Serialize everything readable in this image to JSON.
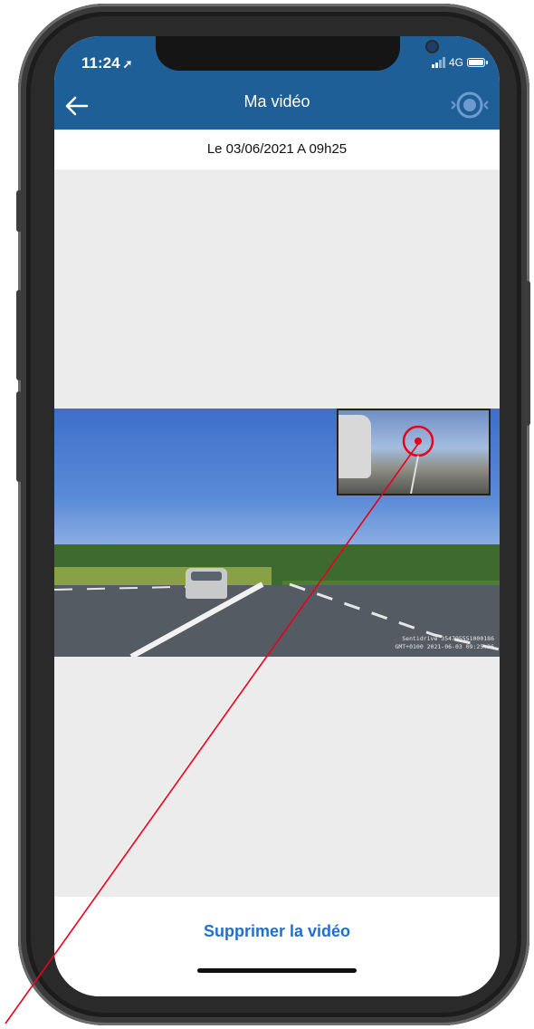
{
  "status_bar": {
    "time": "11:24",
    "network": "4G"
  },
  "header": {
    "title": "Ma vidéo"
  },
  "recording": {
    "date_text": "Le 03/06/2021 A 09h25"
  },
  "video": {
    "overlay_line1": "Sentidrive  354795551000186",
    "overlay_line2": "GMT+0100  2021-06-03  09:25:26"
  },
  "actions": {
    "delete_label": "Supprimer la vidéo"
  },
  "colors": {
    "header_bg": "#1e5f97",
    "link": "#1f6fd1",
    "annotation": "#e8001c"
  },
  "icons": [
    "back-arrow-icon",
    "dashcam-icon",
    "location-arrow-icon",
    "signal-icon",
    "battery-icon"
  ]
}
